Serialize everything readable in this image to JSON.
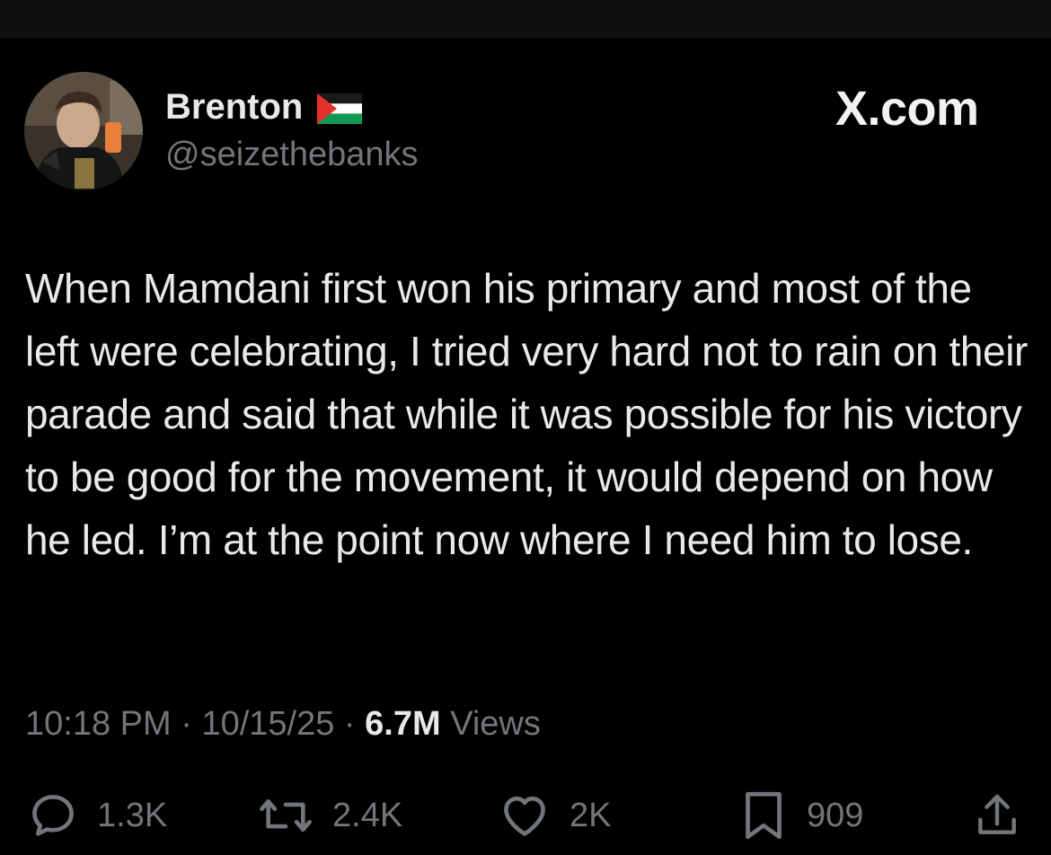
{
  "author": {
    "display_name": "Brenton",
    "handle": "@seizethebanks",
    "flag_icon": "palestine-flag-icon",
    "avatar_icon": "profile-photo"
  },
  "brand": {
    "label": "X.com"
  },
  "tweet": {
    "text": "When Mamdani first won his primary and most of the left were celebrating, I tried very hard not to rain on their parade and said that while it was possible for his victory to be good for the movement, it would depend on how he led. I’m at the point now where I need him to lose."
  },
  "meta": {
    "time": "10:18 PM",
    "separator": "·",
    "date": "10/15/25",
    "views_count": "6.7M",
    "views_label": "Views"
  },
  "actions": {
    "replies": "1.3K",
    "reposts": "2.4K",
    "likes": "2K",
    "bookmarks": "909"
  },
  "colors": {
    "background": "#000000",
    "primary_text": "#e7e9ea",
    "secondary_text": "#71767b"
  }
}
